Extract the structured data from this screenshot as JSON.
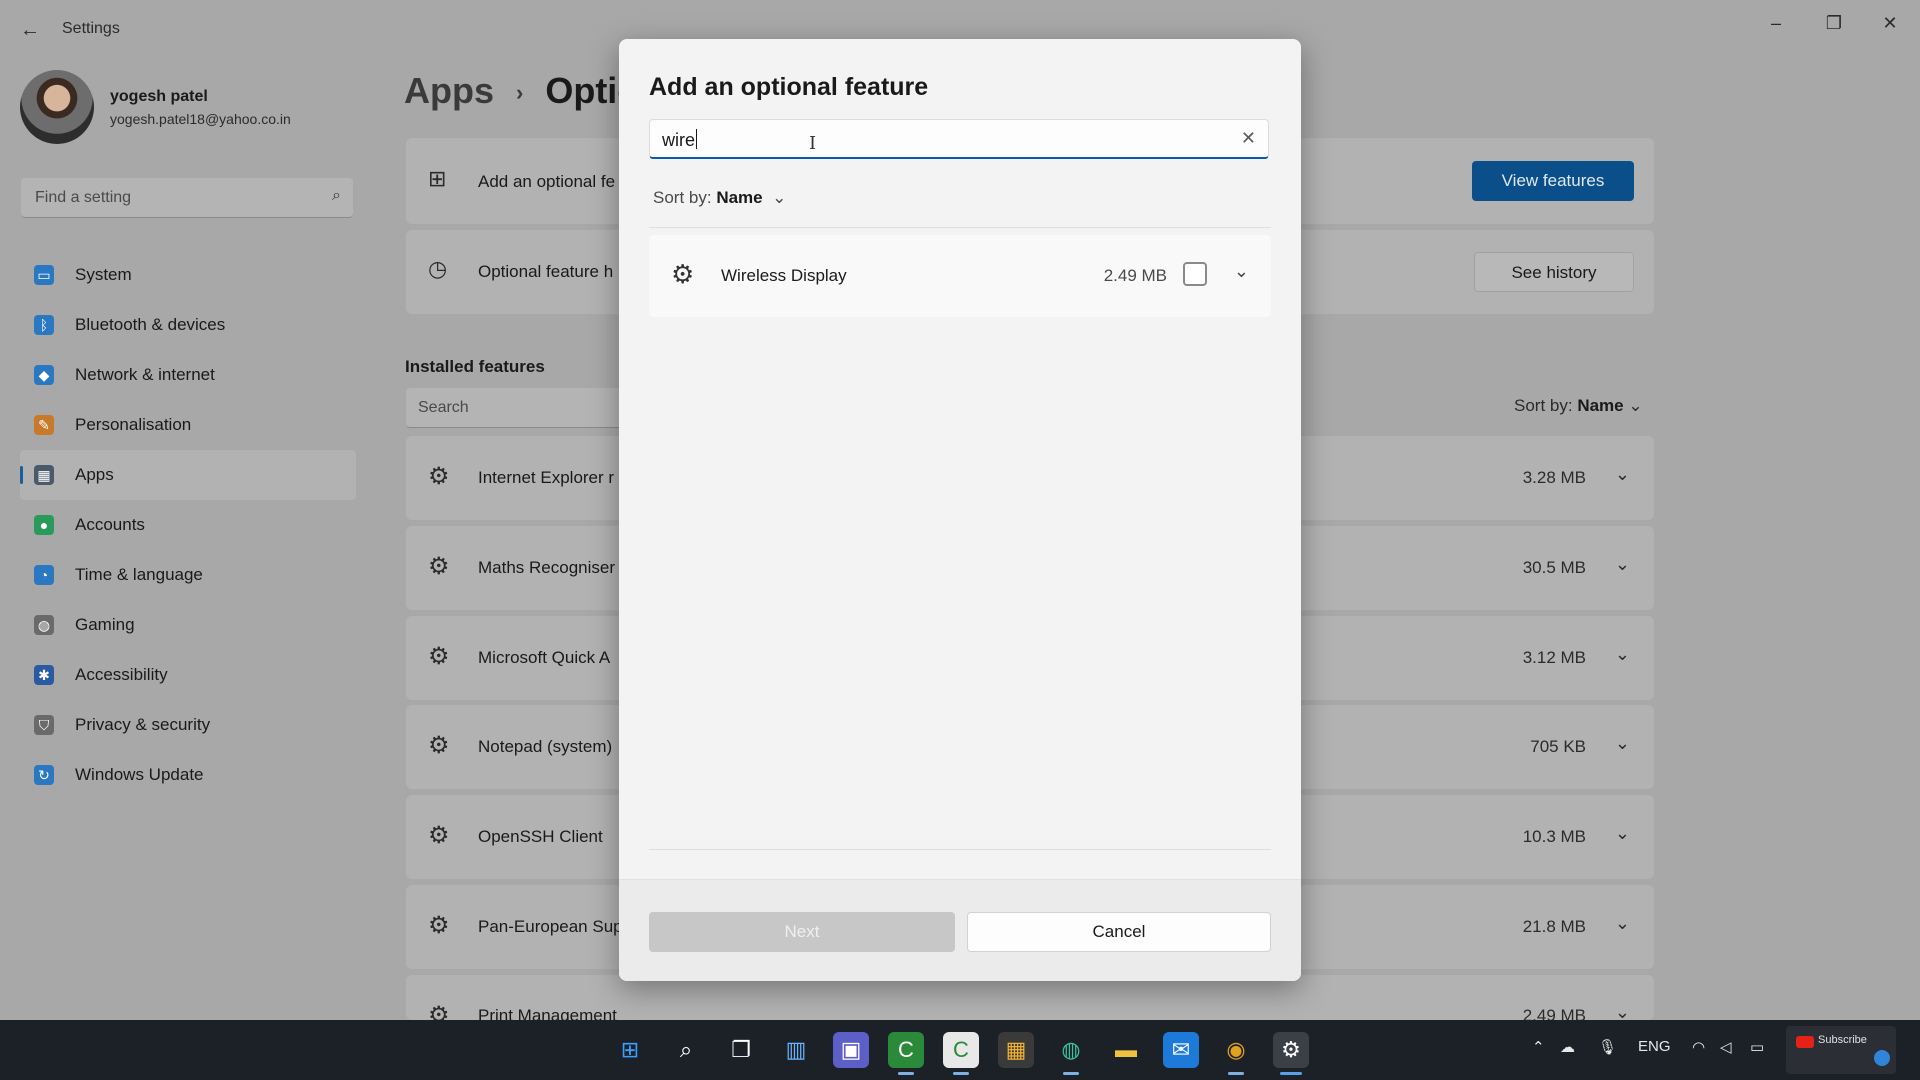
{
  "window": {
    "title": "Settings",
    "back_icon": "←",
    "minimize": "–",
    "maximize": "❐",
    "close": "✕"
  },
  "profile": {
    "name": "yogesh patel",
    "email": "yogesh.patel18@yahoo.co.in"
  },
  "find": {
    "placeholder": "Find a setting",
    "icon": "⌕"
  },
  "nav": [
    {
      "label": "System",
      "icon": "▭",
      "color": "#2a78c2"
    },
    {
      "label": "Bluetooth & devices",
      "icon": "ᛒ",
      "color": "#2a78c2"
    },
    {
      "label": "Network & internet",
      "icon": "◆",
      "color": "#2a78c2"
    },
    {
      "label": "Personalisation",
      "icon": "✎",
      "color": "#c87a2a"
    },
    {
      "label": "Apps",
      "icon": "▦",
      "color": "#4a5a6a"
    },
    {
      "label": "Accounts",
      "icon": "●",
      "color": "#2a9a5a"
    },
    {
      "label": "Time & language",
      "icon": "◔",
      "color": "#2a78c2"
    },
    {
      "label": "Gaming",
      "icon": "◍",
      "color": "#6a6a6a"
    },
    {
      "label": "Accessibility",
      "icon": "✱",
      "color": "#2a5aa2"
    },
    {
      "label": "Privacy & security",
      "icon": "⛉",
      "color": "#6a6a6a"
    },
    {
      "label": "Windows Update",
      "icon": "↻",
      "color": "#2a78c2"
    }
  ],
  "breadcrumb": {
    "parent": "Apps",
    "separator": "›",
    "current": "Optic"
  },
  "cards": {
    "add_label": "Add an optional fe",
    "add_icon": "⊞",
    "view_features": "View features",
    "history_label": "Optional feature h",
    "history_icon": "◷",
    "see_history": "See history"
  },
  "installed": {
    "title": "Installed features",
    "search_placeholder": "Search",
    "sort_label": "Sort by:",
    "sort_value": "Name",
    "items": [
      {
        "name": "Internet Explorer r",
        "size": "3.28 MB"
      },
      {
        "name": "Maths Recogniser",
        "size": "30.5 MB"
      },
      {
        "name": "Microsoft Quick A",
        "size": "3.12 MB"
      },
      {
        "name": "Notepad (system)",
        "size": "705 KB"
      },
      {
        "name": "OpenSSH Client",
        "size": "10.3 MB"
      },
      {
        "name": "Pan-European Sup",
        "size": "21.8 MB"
      },
      {
        "name": "Print Management",
        "size": "2.49 MB"
      }
    ]
  },
  "dialog": {
    "title": "Add an optional feature",
    "search_value": "wire",
    "clear_icon": "✕",
    "sort_label": "Sort by:",
    "sort_value": "Name",
    "results": [
      {
        "name": "Wireless Display",
        "size": "2.49 MB",
        "checked": false
      }
    ],
    "next": "Next",
    "cancel": "Cancel"
  },
  "taskbar": {
    "language": "ENG",
    "subscribe": "Subscribe",
    "icons": [
      "start-icon",
      "search-icon",
      "task-view-icon",
      "widgets-icon",
      "chat-icon",
      "camtasia-icon",
      "camtasia-recorder-icon",
      "store-icon",
      "edge-icon",
      "file-explorer-icon",
      "mail-icon",
      "chrome-icon",
      "settings-icon"
    ]
  }
}
